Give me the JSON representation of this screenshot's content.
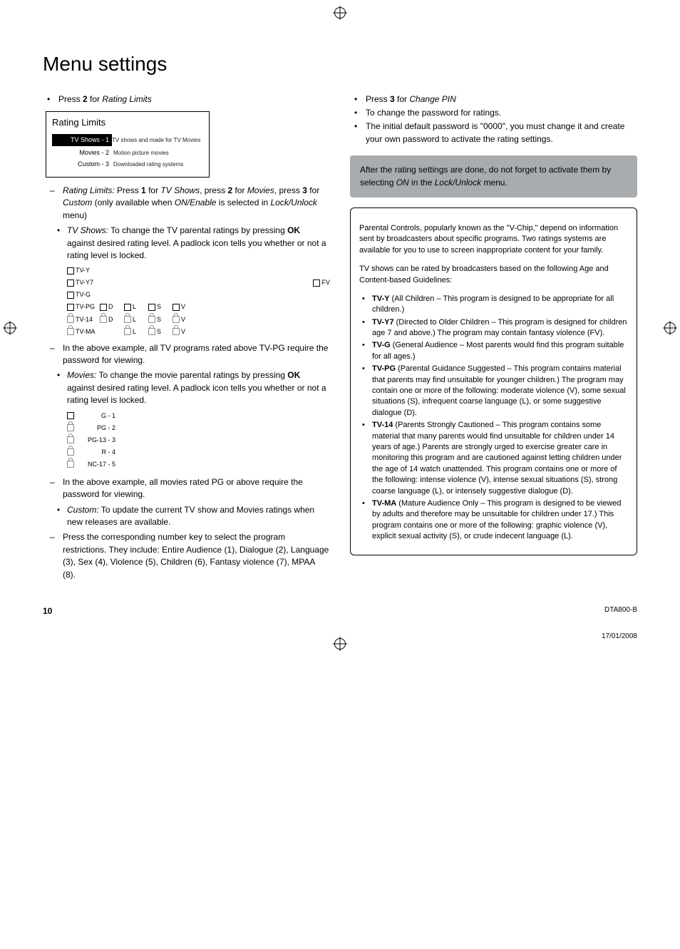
{
  "title": "Menu settings",
  "left": {
    "press2": {
      "text1": "Press ",
      "key": "2",
      "text2": " for ",
      "action": "Rating Limits"
    },
    "panel": {
      "title": "Rating Limits",
      "rows": [
        {
          "label": "TV Shows - 1",
          "desc": "TV shows and made for TV Movies",
          "selected": true
        },
        {
          "label": "Movies - 2",
          "desc": "Motion picture movies",
          "selected": false
        },
        {
          "label": "Custom - 3",
          "desc": "Downloaded rating systems",
          "selected": false
        }
      ]
    },
    "rating_limits_line": {
      "lead": "Rating Limits:",
      "t1": " Press ",
      "k1": "1",
      "t2": " for ",
      "a1": "TV Shows",
      "t3": ", press ",
      "k2": "2",
      "t4": " for ",
      "a2": "Movies",
      "t5": ", press ",
      "k3": "3",
      "t6": " for ",
      "a3": "Custom",
      "t7": " (only available when ",
      "a4": "ON/Enable",
      "t8": " is selected in ",
      "a5": "Lock/Unlock",
      "t9": " menu)"
    },
    "tvshows_line": {
      "lead": "TV Shows:",
      "body": " To change the TV parental ratings by pressing ",
      "ok": "OK",
      "tail": " against desired rating level. A padlock icon tells you whether or not a rating level is locked."
    },
    "tvgrid": {
      "rows": [
        {
          "icon": "chk",
          "label": "TV-Y",
          "cells": []
        },
        {
          "icon": "chk",
          "label": "TV-Y7",
          "cells": [],
          "fv": {
            "icon": "chk",
            "label": "FV"
          }
        },
        {
          "icon": "chk",
          "label": "TV-G",
          "cells": []
        },
        {
          "icon": "chk",
          "label": "TV-PG",
          "cells": [
            {
              "icon": "chk",
              "t": "D"
            },
            {
              "icon": "chk",
              "t": "L"
            },
            {
              "icon": "chk",
              "t": "S"
            },
            {
              "icon": "chk",
              "t": "V"
            }
          ]
        },
        {
          "icon": "lck",
          "label": "TV-14",
          "cells": [
            {
              "icon": "lck",
              "t": "D"
            },
            {
              "icon": "lck",
              "t": "L"
            },
            {
              "icon": "lck",
              "t": "S"
            },
            {
              "icon": "lck",
              "t": "V"
            }
          ]
        },
        {
          "icon": "lck",
          "label": "TV-MA",
          "cells": [
            {
              "icon": "",
              "t": ""
            },
            {
              "icon": "lck",
              "t": "L"
            },
            {
              "icon": "lck",
              "t": "S"
            },
            {
              "icon": "lck",
              "t": "V"
            }
          ]
        }
      ]
    },
    "tv_example": "In the above example, all TV programs rated above TV-PG require the password for viewing.",
    "movies_line": {
      "lead": "Movies:",
      "body": " To change the movie parental ratings by pressing ",
      "ok": "OK",
      "tail": " against desired rating level. A padlock icon tells you whether or not a rating level is locked."
    },
    "moviegrid": [
      {
        "icon": "chk",
        "label": "G - 1"
      },
      {
        "icon": "lck",
        "label": "PG - 2"
      },
      {
        "icon": "lck",
        "label": "PG-13 - 3"
      },
      {
        "icon": "lck",
        "label": "R - 4"
      },
      {
        "icon": "lck",
        "label": "NC-17 - 5"
      }
    ],
    "movie_example": "In the above example, all movies rated PG or above require the password for viewing.",
    "custom_line": {
      "lead": "Custom:",
      "body": " To update the current TV show and Movies ratings when new releases are available."
    },
    "number_line": "Press the corresponding number key to select the program restrictions. They include: Entire Audience (1), Dialogue (2), Language (3), Sex (4), Violence (5), Children (6), Fantasy violence (7), MPAA (8)."
  },
  "right": {
    "press3": {
      "text1": "Press ",
      "key": "3",
      "text2": " for ",
      "action": "Change PIN"
    },
    "line2": "To change the password for ratings.",
    "line3": "The initial default password is \"0000\", you must change it and create your own password to activate the rating settings.",
    "notebox": {
      "t1": "After the rating settings are done, do not forget to activate them by selecting ",
      "on": "ON",
      "t2": " in the ",
      "menu": "Lock/Unlock",
      "t3": " menu."
    },
    "info": {
      "p1": "Parental Controls, popularly known as the \"V-Chip,\" depend on information sent by broadcasters about specific programs. Two ratings systems are available for you to use to screen inappropriate content for your family.",
      "p2": "TV shows can be rated by broadcasters based on the following Age and Content-based Guidelines:",
      "items": [
        {
          "b": "TV-Y",
          "t": " (All Children – This program is designed to be appropriate for all children.)"
        },
        {
          "b": "TV-Y7",
          "t": " (Directed to Older Children – This program is designed for children age 7 and above.) The program may contain fantasy violence (FV)."
        },
        {
          "b": "TV-G",
          "t": " (General Audience – Most parents would find this program suitable for all ages.)"
        },
        {
          "b": "TV-PG",
          "t": " (Parental Guidance Suggested – This program contains material that parents may find unsuitable for younger children.) The program may contain one or more of the following: moderate violence (V), some sexual situations (S), infrequent coarse language (L), or some suggestive dialogue (D)."
        },
        {
          "b": "TV-14",
          "t": " (Parents Strongly Cautioned – This program contains some material that many parents would find unsuitable for children under 14 years of age.) Parents are strongly urged to exercise greater care in monitoring this program and are cautioned against letting children under the age of 14 watch unattended. This program contains one or more of the following: intense violence (V), intense sexual situations (S), strong coarse language (L), or intensely suggestive dialogue (D)."
        },
        {
          "b": "TV-MA",
          "t": " (Mature Audience Only – This program is designed to be viewed by adults and therefore may be unsuitable for children under 17.) This program contains one or more of the following: graphic violence (V), explicit sexual activity (S), or crude indecent language (L)."
        }
      ]
    }
  },
  "footer": {
    "page": "10",
    "model": "DTA800-B",
    "date": "17/01/2008"
  }
}
